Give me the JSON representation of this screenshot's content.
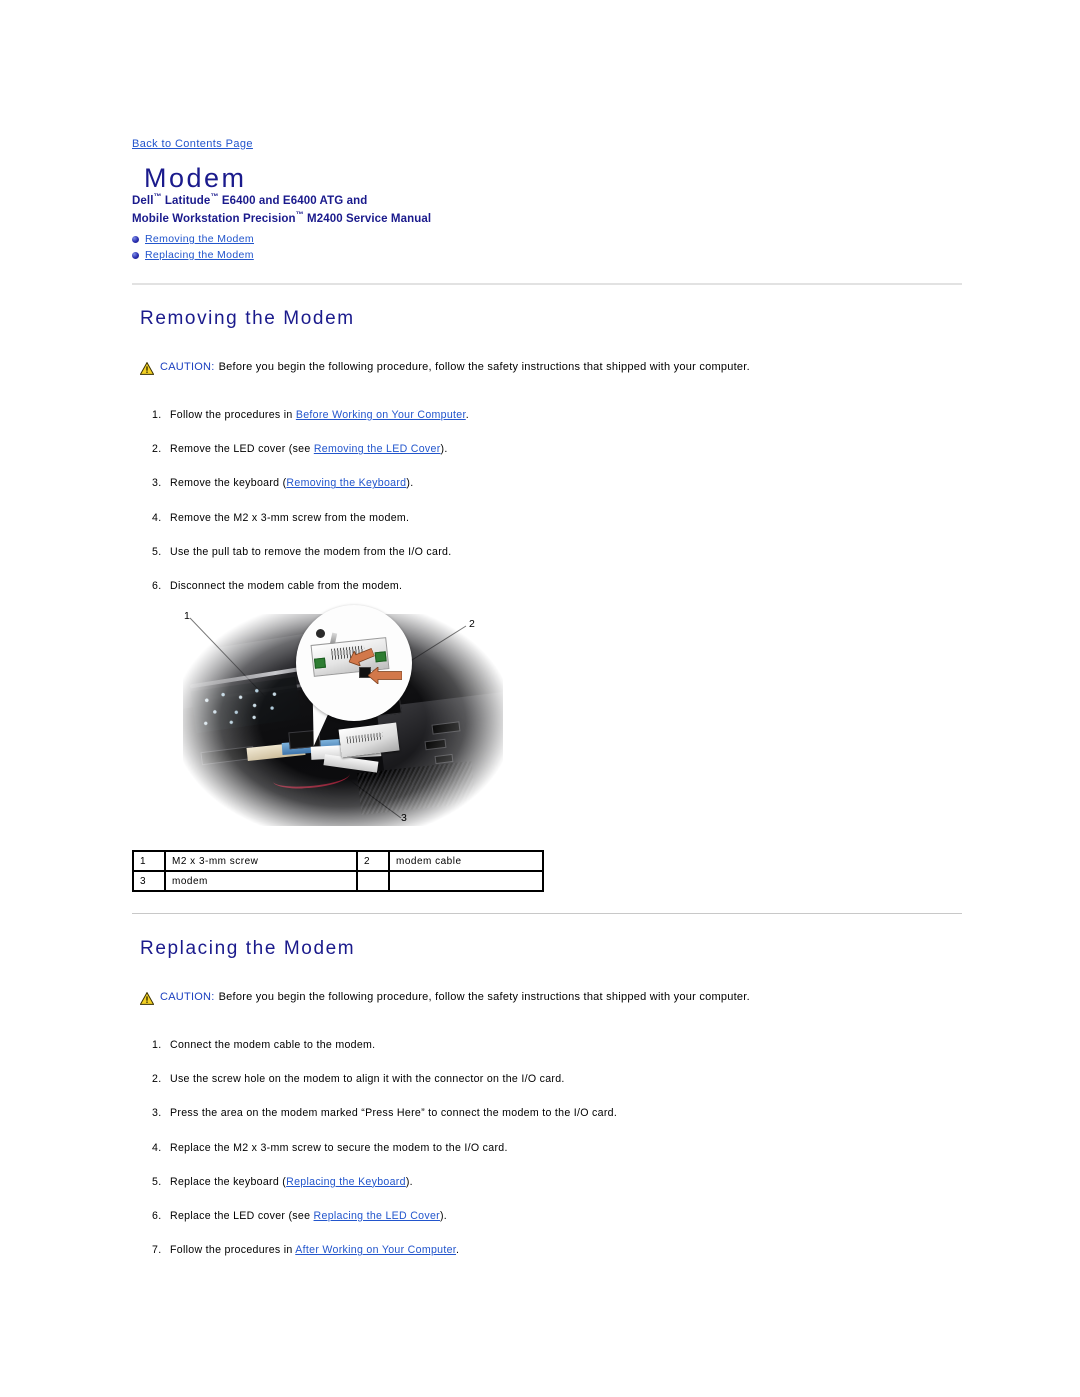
{
  "document": {
    "back_link": "Back to Contents Page",
    "title": "Modem",
    "subtitle_line1_pre": "Dell",
    "subtitle_line1_tm1": "™",
    "subtitle_line1_mid": " Latitude",
    "subtitle_line1_tm2": "™",
    "subtitle_line1_post": " E6400 and E6400 ATG and",
    "subtitle_line2_pre": "Mobile Workstation Precision",
    "subtitle_line2_tm": "™",
    "subtitle_line2_post": " M2400 Service Manual",
    "toc": [
      {
        "label": "Removing the Modem"
      },
      {
        "label": "Replacing the Modem"
      }
    ]
  },
  "removing": {
    "heading": "Removing the Modem",
    "caution_word": "CAUTION:",
    "caution_text": "Before you begin the following procedure, follow the safety instructions that shipped with your computer.",
    "steps": [
      {
        "num": "1.",
        "pre": "Follow the procedures in ",
        "link": "Before Working on Your Computer",
        "post": "."
      },
      {
        "num": "2.",
        "pre": "Remove the LED cover (see ",
        "link": "Removing the LED Cover",
        "post": ")."
      },
      {
        "num": "3.",
        "pre": "Remove the keyboard (",
        "link": "Removing the Keyboard",
        "post": ")."
      },
      {
        "num": "4.",
        "pre": "Remove the M2 x 3-mm screw from the modem.",
        "link": "",
        "post": ""
      },
      {
        "num": "5.",
        "pre": "Use the pull tab to remove the modem from the I/O card.",
        "link": "",
        "post": ""
      },
      {
        "num": "6.",
        "pre": "Disconnect the modem cable from the modem.",
        "link": "",
        "post": ""
      }
    ]
  },
  "figure": {
    "callouts": [
      {
        "id": "1"
      },
      {
        "id": "2"
      },
      {
        "id": "3"
      }
    ],
    "legend": [
      {
        "index": "1",
        "label": "M2 x 3-mm screw",
        "index2": "2",
        "label2": "modem cable"
      },
      {
        "index": "3",
        "label": "modem",
        "index2": "",
        "label2": ""
      }
    ]
  },
  "replacing": {
    "heading": "Replacing the Modem",
    "caution_word": "CAUTION:",
    "caution_text": "Before you begin the following procedure, follow the safety instructions that shipped with your computer.",
    "steps": [
      {
        "num": "1.",
        "pre": "Connect the modem cable to the modem.",
        "link": "",
        "post": ""
      },
      {
        "num": "2.",
        "pre": "Use the screw hole on the modem to align it with the connector on the I/O card.",
        "link": "",
        "post": ""
      },
      {
        "num": "3.",
        "pre": "Press the area on the modem marked “Press Here” to connect the modem to the I/O card.",
        "link": "",
        "post": ""
      },
      {
        "num": "4.",
        "pre": "Replace the M2 x 3-mm screw to secure the modem to the I/O card.",
        "link": "",
        "post": ""
      },
      {
        "num": "5.",
        "pre": "Replace the keyboard (",
        "link": "Replacing the Keyboard",
        "post": ")."
      },
      {
        "num": "6.",
        "pre": "Replace the LED cover (see ",
        "link": "Replacing the LED Cover",
        "post": ")."
      },
      {
        "num": "7.",
        "pre": "Follow the procedures in ",
        "link": "After Working on Your Computer",
        "post": "."
      }
    ]
  },
  "colors": {
    "heading_blue": "#1a1a8c",
    "link_blue": "#2255cc",
    "caution_yellow": "#f2d024",
    "rule_gray": "#e2e2e2"
  }
}
